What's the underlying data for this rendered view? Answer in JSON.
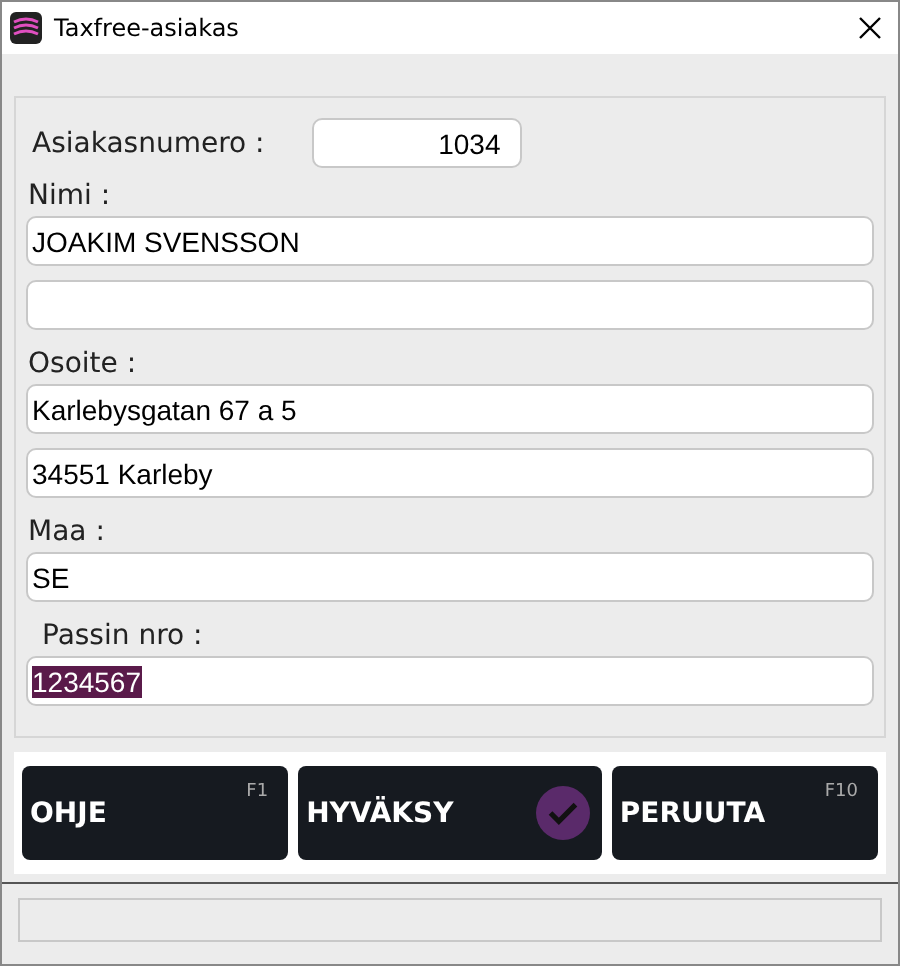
{
  "window": {
    "title": "Taxfree-asiakas"
  },
  "customer_number": {
    "label": "Asiakasnumero :",
    "value": "1034"
  },
  "groups": [
    {
      "label": "Nimi :",
      "fields": [
        {
          "kind": "text",
          "value": "JOAKIM SVENSSON",
          "text_selected": false
        },
        {
          "kind": "blank"
        }
      ]
    },
    {
      "label": "Osoite :",
      "fields": [
        {
          "kind": "text",
          "value": "Karlebysgatan 67 a 5",
          "text_selected": false
        },
        {
          "kind": "text",
          "value": "34551 Karleby",
          "text_selected": false
        }
      ]
    },
    {
      "label": "Maa :",
      "fields": [
        {
          "kind": "text",
          "value": "SE",
          "text_selected": false
        }
      ]
    },
    {
      "label": "Passin nro :",
      "fields": [
        {
          "kind": "text",
          "value": "1234567",
          "text_selected": true
        }
      ]
    }
  ],
  "buttons": [
    {
      "label": "OHJE",
      "kind": "key",
      "key": "F1"
    },
    {
      "label": "HYVÄKSY",
      "kind": "confirm"
    },
    {
      "label": "PERUUTA",
      "kind": "key",
      "key": "F10"
    }
  ]
}
